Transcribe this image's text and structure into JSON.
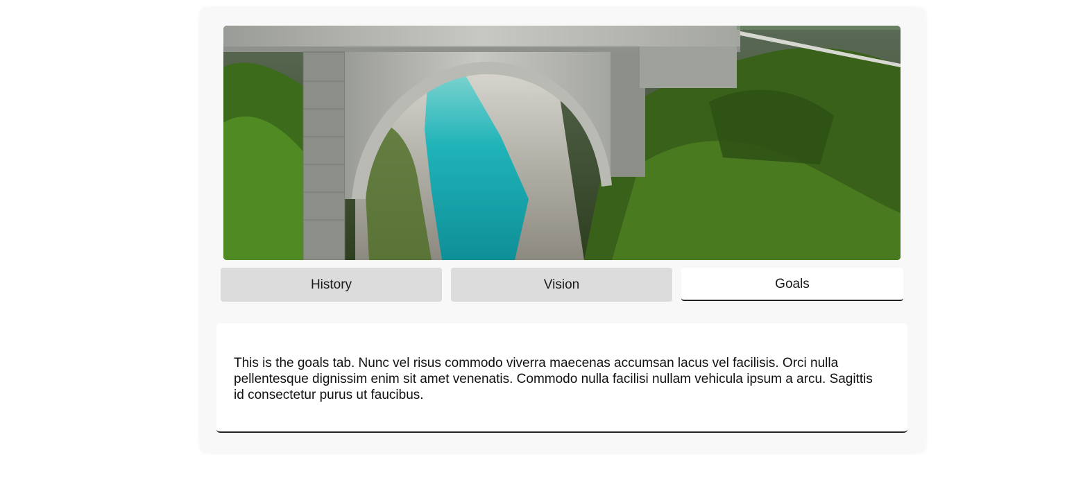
{
  "hero": {
    "alt": "Stone arch bridge over a turquoise river gorge"
  },
  "tabs": [
    {
      "label": "History",
      "active": false
    },
    {
      "label": "Vision",
      "active": false
    },
    {
      "label": "Goals",
      "active": true
    }
  ],
  "panel": {
    "text": "This is the goals tab. Nunc vel risus commodo viverra maecenas accumsan lacus vel facilisis. Orci nulla pellentesque dignissim enim sit amet venenatis. Commodo nulla facilisi nullam vehicula ipsum a arcu. Sagittis id consectetur purus ut faucibus."
  },
  "colors": {
    "card_bg": "#f8f8f8",
    "tab_inactive": "#dcdcdc",
    "tab_active": "#ffffff",
    "river": "#1fb3b8",
    "foliage": "#3f6a1e"
  }
}
